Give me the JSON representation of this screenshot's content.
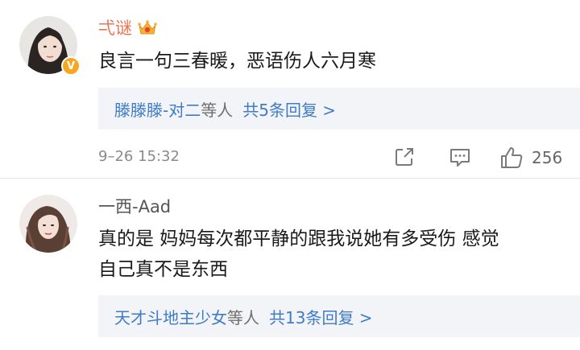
{
  "comments": [
    {
      "username": "弌谜",
      "text": "良言一句三春暖，恶语伤人六月寒",
      "reply_names": "滕滕滕-对二",
      "reply_suffix": "等人",
      "reply_total": "共5条回复 >",
      "timestamp": "9–26 15:32",
      "likes": "256",
      "verified_badge": "V",
      "icons": [
        "crown-member-icon",
        "share-icon",
        "comment-icon",
        "like-icon"
      ]
    },
    {
      "username": "一西-Aad",
      "text_line1": "真的是 妈妈每次都平静的跟我说她有多受伤 感觉",
      "text_line2": "自己真不是东西",
      "reply_names": "天才斗地主少女",
      "reply_suffix": "等人",
      "reply_total": "共13条回复 >"
    }
  ],
  "colors": {
    "username_highlight": "#eb7350",
    "link_blue": "#3e7bc9",
    "reply_bg": "#f2f4f7",
    "verified_orange": "#f6a623"
  }
}
